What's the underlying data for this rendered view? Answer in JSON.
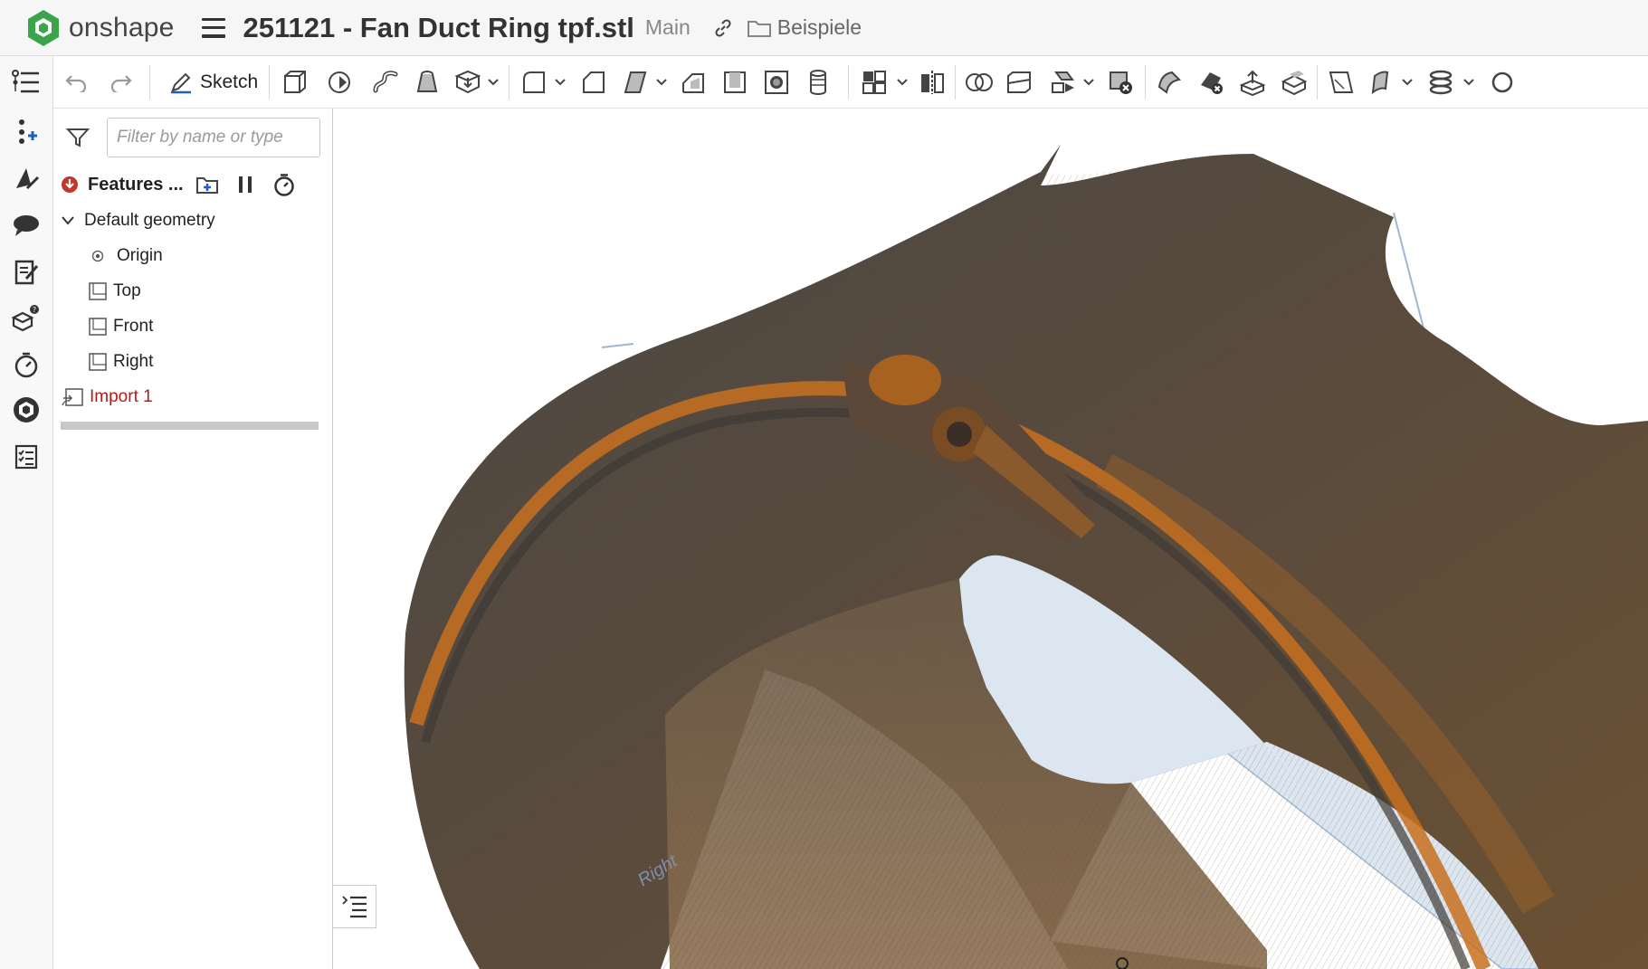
{
  "app": {
    "name": "onshape"
  },
  "document": {
    "title": "251121 - Fan Duct Ring tpf.stl",
    "branch": "Main",
    "folder": "Beispiele"
  },
  "toolbar": {
    "sketch_label": "Sketch"
  },
  "feature_panel": {
    "filter_placeholder": "Filter by name or type",
    "header_label": "Features ...",
    "tree": {
      "group_label": "Default geometry",
      "origin_label": "Origin",
      "planes": [
        "Top",
        "Front",
        "Right"
      ],
      "import_label": "Import 1"
    }
  },
  "viewport": {
    "plane_watermark": "Right"
  },
  "colors": {
    "brand_green": "#3aa44a",
    "model_dark": "#4a4744",
    "model_orange": "#c8701e",
    "plane_blue": "#dce6f0",
    "import_red": "#b31b1b"
  }
}
